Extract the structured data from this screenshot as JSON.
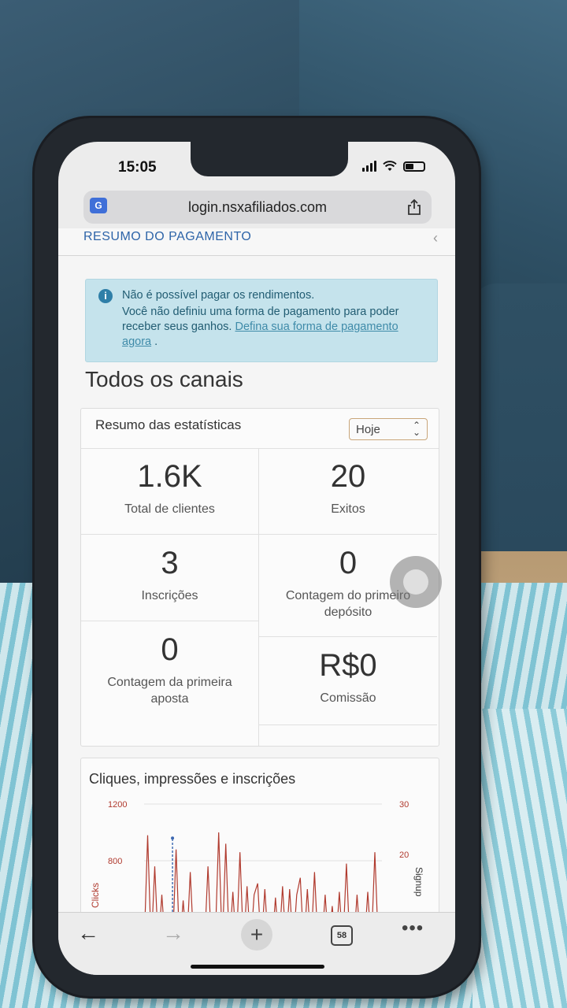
{
  "status_bar": {
    "time": "15:05"
  },
  "browser": {
    "url": "login.nsxafiliados.com",
    "tabs_count": "58"
  },
  "section": {
    "title": "RESUMO DO PAGAMENTO"
  },
  "alert": {
    "title": "Não é possível pagar os rendimentos.",
    "body": "Você não definiu uma forma de pagamento para poder receber seus ganhos. ",
    "link": "Defina sua forma de pagamento agora",
    "suffix": " ."
  },
  "heading": "Todos os canais",
  "stats": {
    "title": "Resumo das estatísticas",
    "period": "Hoje",
    "items": [
      {
        "value": "1.6K",
        "label": "Total de clientes"
      },
      {
        "value": "20",
        "label": "Exitos"
      },
      {
        "value": "3",
        "label": "Inscrições"
      },
      {
        "value": "0",
        "label": "Contagem do primeiro depósito"
      },
      {
        "value": "0",
        "label": "Contagem da primeira aposta"
      },
      {
        "value": "R$0",
        "label": "Comissão"
      }
    ]
  },
  "chart_data": {
    "type": "line",
    "title": "Cliques, impressões e inscrições",
    "ylabel": "Clicks",
    "y2label": "Signup",
    "yticks": [
      1200,
      800
    ],
    "y2ticks": [
      30,
      20
    ],
    "ylim": [
      0,
      1200
    ],
    "series": [
      {
        "color": "#b03a2e",
        "values": [
          0,
          980,
          0,
          760,
          0,
          560,
          0,
          0,
          0,
          880,
          0,
          520,
          0,
          720,
          0,
          0,
          0,
          0,
          760,
          0,
          0,
          1000,
          0,
          920,
          0,
          580,
          0,
          860,
          0,
          620,
          0,
          560,
          640,
          0,
          600,
          0,
          0,
          540,
          0,
          620,
          0,
          600,
          0,
          560,
          680,
          0,
          600,
          0,
          720,
          0,
          0,
          560,
          0,
          480,
          0,
          580,
          0,
          780,
          0,
          0,
          560,
          0,
          0,
          580,
          0,
          860,
          0,
          0
        ]
      },
      {
        "color": "#3a66b0",
        "values": [
          0,
          0,
          0,
          0,
          0,
          0,
          0,
          0,
          0,
          0,
          0,
          0,
          0,
          0,
          0,
          0,
          0,
          0,
          0,
          0,
          0,
          0,
          0,
          0,
          0,
          0,
          0,
          0,
          0,
          0,
          0,
          0,
          0,
          0,
          0,
          0,
          0,
          0,
          0,
          0,
          0,
          0,
          0,
          0,
          0,
          0,
          0,
          0,
          0,
          0,
          0,
          0,
          0,
          0,
          0,
          0,
          0,
          0,
          0,
          0,
          0,
          0,
          0,
          0,
          0,
          0,
          0,
          0
        ],
        "spike_index": 8,
        "spike_value": 960
      }
    ]
  },
  "icons": {
    "translate": "translate-icon",
    "share": "share-icon",
    "info": "info-icon",
    "back": "back-arrow-icon",
    "forward": "forward-arrow-icon",
    "new_tab": "plus-icon",
    "tabs": "tabs-icon",
    "more": "more-icon"
  }
}
